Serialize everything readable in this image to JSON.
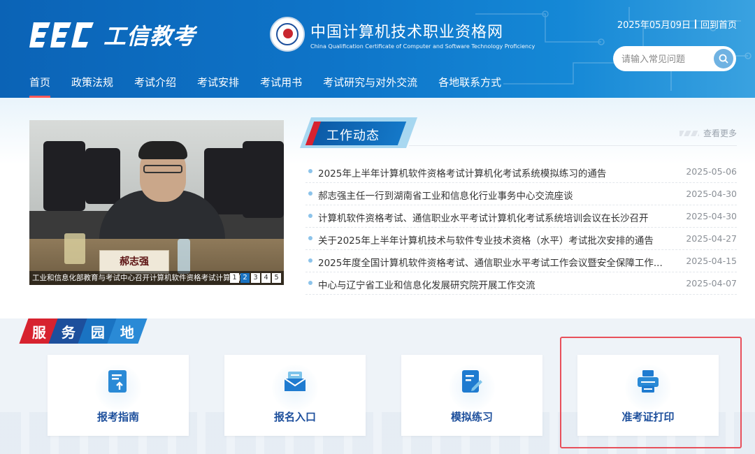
{
  "header": {
    "logo_text": "工信教考",
    "org_cn": "中国计算机技术职业资格网",
    "org_en": "China Qualification Certificate of Computer and Software Technology Proficiency",
    "date": "2025年05月09日",
    "home_link": "回到首页",
    "search_placeholder": "请输入常见问题"
  },
  "nav": {
    "items": [
      "首页",
      "政策法规",
      "考试介绍",
      "考试安排",
      "考试用书",
      "考试研究与对外交流",
      "各地联系方式"
    ],
    "active_index": 0
  },
  "carousel": {
    "caption": "工业和信息化部教育与考试中心召开计算机软件资格考试计算机化",
    "nameplate": "郝志强",
    "pages": [
      "1",
      "2",
      "3",
      "4",
      "5"
    ],
    "active_page": "2"
  },
  "news": {
    "title": "工作动态",
    "more": "查看更多",
    "items": [
      {
        "title": "2025年上半年计算机软件资格考试计算机化考试系统模拟练习的通告",
        "date": "2025-05-06"
      },
      {
        "title": "郝志强主任一行到湖南省工业和信息化行业事务中心交流座谈",
        "date": "2025-04-30"
      },
      {
        "title": "计算机软件资格考试、通信职业水平考试计算机化考试系统培训会议在长沙召开",
        "date": "2025-04-30"
      },
      {
        "title": "关于2025年上半年计算机技术与软件专业技术资格（水平）考试批次安排的通告",
        "date": "2025-04-27"
      },
      {
        "title": "2025年度全国计算机软件资格考试、通信职业水平考试工作会议暨安全保障工作...",
        "date": "2025-04-15"
      },
      {
        "title": "中心与辽宁省工业和信息化发展研究院开展工作交流",
        "date": "2025-04-07"
      }
    ]
  },
  "service": {
    "tag": [
      "服",
      "务",
      "园",
      "地"
    ],
    "cards": [
      {
        "label": "报考指南",
        "icon": "guide-icon"
      },
      {
        "label": "报名入口",
        "icon": "register-icon"
      },
      {
        "label": "模拟练习",
        "icon": "practice-icon"
      },
      {
        "label": "准考证打印",
        "icon": "printer-icon"
      }
    ]
  },
  "colors": {
    "brand_blue": "#0e75c9",
    "dark_blue": "#1d4f9c",
    "accent_red": "#d7222f",
    "highlight_red": "#e8505b"
  }
}
